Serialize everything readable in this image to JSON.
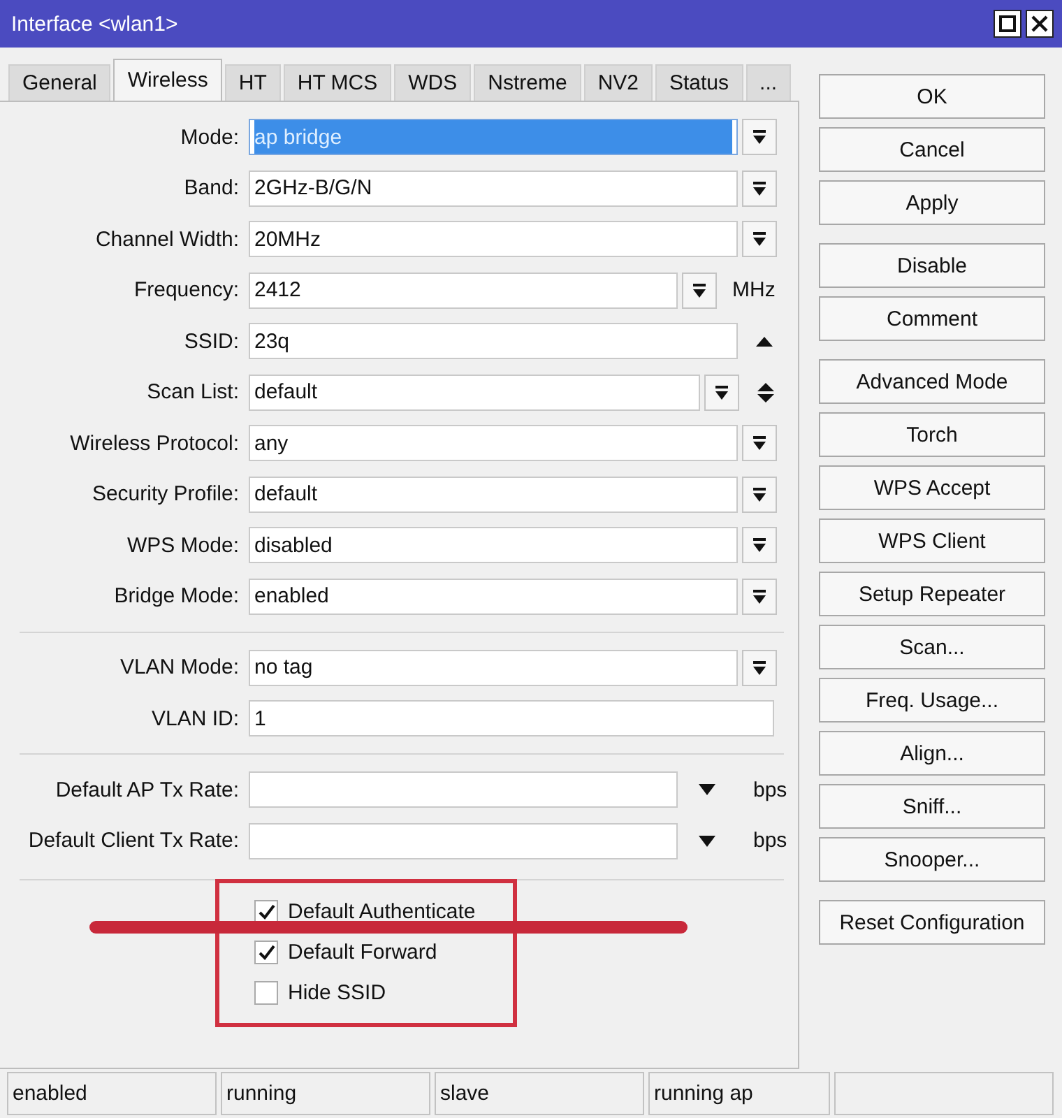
{
  "window": {
    "title": "Interface <wlan1>"
  },
  "tabs": [
    {
      "label": "General",
      "selected": false
    },
    {
      "label": "Wireless",
      "selected": true
    },
    {
      "label": "HT",
      "selected": false
    },
    {
      "label": "HT MCS",
      "selected": false
    },
    {
      "label": "WDS",
      "selected": false
    },
    {
      "label": "Nstreme",
      "selected": false
    },
    {
      "label": "NV2",
      "selected": false
    },
    {
      "label": "Status",
      "selected": false
    },
    {
      "label": "...",
      "selected": false
    }
  ],
  "groups": [
    {
      "fields": [
        {
          "kind": "dropdown",
          "label": "Mode:",
          "value": "ap bridge",
          "highlighted": true
        },
        {
          "kind": "dropdown",
          "label": "Band:",
          "value": "2GHz-B/G/N",
          "highlighted": false
        },
        {
          "kind": "dropdown",
          "label": "Channel Width:",
          "value": "20MHz",
          "highlighted": false
        },
        {
          "kind": "unit",
          "label": "Frequency:",
          "value": "2412",
          "unit": "MHz",
          "highlighted": false
        },
        {
          "kind": "collapse",
          "label": "SSID:",
          "value": "23q",
          "highlighted": false
        },
        {
          "kind": "scan",
          "label": "Scan List:",
          "value": "default",
          "highlighted": false
        },
        {
          "kind": "dropdown",
          "label": "Wireless Protocol:",
          "value": "any",
          "highlighted": false
        },
        {
          "kind": "dropdown",
          "label": "Security Profile:",
          "value": "default",
          "highlighted": false
        },
        {
          "kind": "dropdown",
          "label": "WPS Mode:",
          "value": "disabled",
          "highlighted": false
        },
        {
          "kind": "dropdown",
          "label": "Bridge Mode:",
          "value": "enabled",
          "highlighted": false
        }
      ]
    },
    {
      "fields": [
        {
          "kind": "dropdown",
          "label": "VLAN Mode:",
          "value": "no tag",
          "highlighted": false
        },
        {
          "kind": "text",
          "label": "VLAN ID:",
          "value": "1",
          "highlighted": false
        }
      ]
    },
    {
      "fields": [
        {
          "kind": "rate",
          "label": "Default AP Tx Rate:",
          "unit": "bps",
          "highlighted": false
        },
        {
          "kind": "rate",
          "label": "Default Client Tx Rate:",
          "unit": "bps",
          "highlighted": false
        }
      ]
    }
  ],
  "checkboxes": [
    {
      "label": "Default Authenticate",
      "checked": true
    },
    {
      "label": "Default Forward",
      "checked": true
    },
    {
      "label": "Hide SSID",
      "checked": false
    }
  ],
  "button_groups": [
    [
      "OK",
      "Cancel",
      "Apply"
    ],
    [
      "Disable",
      "Comment"
    ],
    [
      "Advanced Mode",
      "Torch",
      "WPS Accept",
      "WPS Client",
      "Setup Repeater",
      "Scan...",
      "Freq. Usage...",
      "Align...",
      "Sniff...",
      "Snooper..."
    ],
    [
      "Reset Configuration"
    ]
  ],
  "status_bar": [
    "enabled",
    "running",
    "slave",
    "running ap"
  ]
}
